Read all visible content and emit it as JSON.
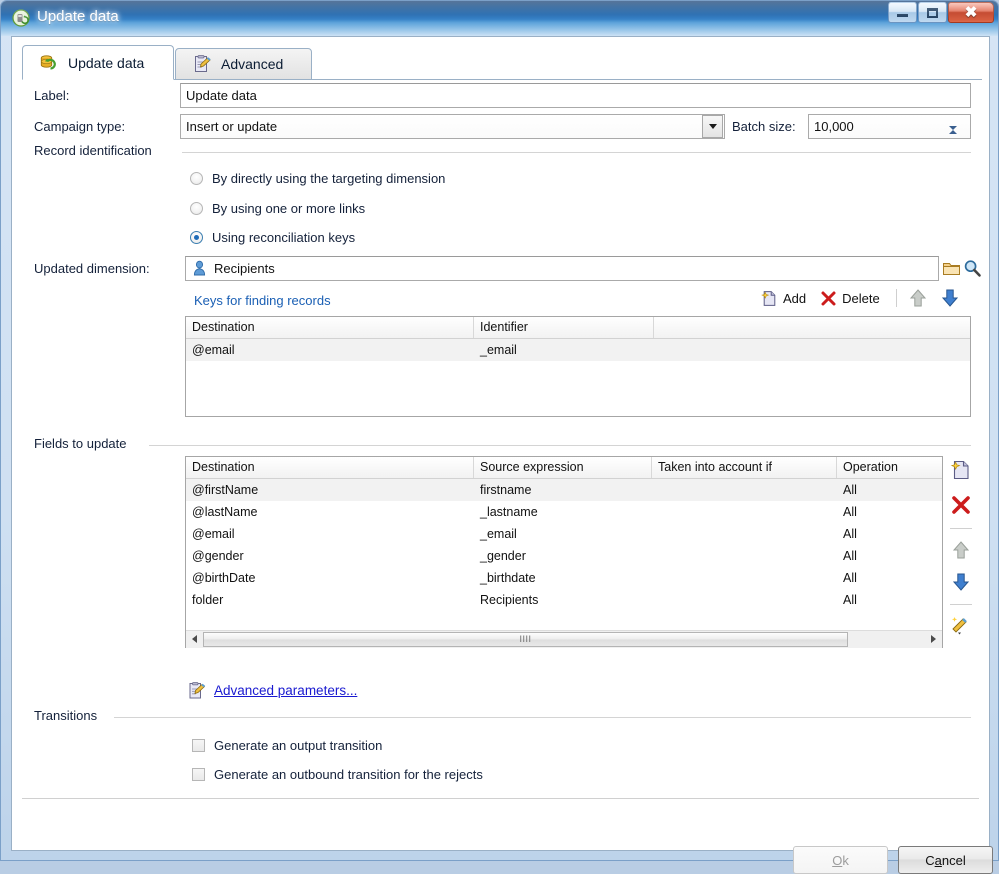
{
  "window": {
    "title": "Update data",
    "icon": "update-data-icon",
    "controls": {
      "minimize": "minimize",
      "maximize": "maximize",
      "close": "close"
    }
  },
  "tabs": [
    {
      "label": "Update data",
      "icon": "update-data-tab-icon",
      "active": true
    },
    {
      "label": "Advanced",
      "icon": "advanced-tab-icon",
      "active": false
    }
  ],
  "form": {
    "label_caption": "Label:",
    "label_value": "Update data",
    "campaign_type_caption": "Campaign type:",
    "campaign_type_value": "Insert or update",
    "batch_size_caption": "Batch size:",
    "batch_size_value": "10,000"
  },
  "record_identification": {
    "title": "Record identification",
    "options": [
      {
        "label": "By directly using the targeting dimension",
        "selected": false
      },
      {
        "label": "By using one or more links",
        "selected": false
      },
      {
        "label": "Using reconciliation keys",
        "selected": true
      }
    ]
  },
  "updated_dimension": {
    "caption": "Updated dimension:",
    "value": "Recipients",
    "value_icon": "recipient-person-icon",
    "browse_icon": "folder-icon",
    "search_icon": "magnifier-icon"
  },
  "keys_section": {
    "title": "Keys for finding records",
    "toolbar": {
      "add_label": "Add",
      "add_icon": "new-document-icon",
      "delete_label": "Delete",
      "delete_icon": "red-x-icon",
      "move_up_icon": "arrow-up-icon",
      "move_down_icon": "arrow-down-icon"
    },
    "columns": [
      "Destination",
      "Identifier",
      ""
    ],
    "rows": [
      {
        "destination": "@email",
        "identifier": "_email"
      }
    ]
  },
  "fields_section": {
    "title": "Fields to update",
    "columns": [
      "Destination",
      "Source expression",
      "Taken into account if",
      "Operation"
    ],
    "rows": [
      {
        "destination": "@firstName",
        "source": "firstname",
        "taken_into_account": "",
        "operation": "All"
      },
      {
        "destination": "@lastName",
        "source": "_lastname",
        "taken_into_account": "",
        "operation": "All"
      },
      {
        "destination": "@email",
        "source": "_email",
        "taken_into_account": "",
        "operation": "All"
      },
      {
        "destination": "@gender",
        "source": "_gender",
        "taken_into_account": "",
        "operation": "All"
      },
      {
        "destination": "@birthDate",
        "source": "_birthdate",
        "taken_into_account": "",
        "operation": "All"
      },
      {
        "destination": "folder",
        "source": "Recipients",
        "taken_into_account": "",
        "operation": "All"
      }
    ],
    "sidebar_icons": [
      "new-document-icon",
      "red-x-icon",
      "arrow-up-icon",
      "arrow-down-icon",
      "magic-wand-icon"
    ],
    "advanced_link": "Advanced parameters...",
    "advanced_link_icon": "advanced-parameters-icon"
  },
  "transitions": {
    "title": "Transitions",
    "options": [
      {
        "label": "Generate an output transition",
        "checked": false
      },
      {
        "label": "Generate an outbound transition for the rejects",
        "checked": false
      }
    ]
  },
  "footer": {
    "ok_label": "Ok",
    "ok_accel": "O",
    "ok_rest": "k",
    "ok_enabled": false,
    "cancel_label": "Cancel",
    "cancel_pre": "C",
    "cancel_accel": "a",
    "cancel_rest": "ncel"
  },
  "colors": {
    "title_bar": "#1b63ab",
    "link": "#1919d0",
    "section_label": "#1a5fb4",
    "selected_radio": "#1e6bb8",
    "close_button": "#bd3417"
  }
}
